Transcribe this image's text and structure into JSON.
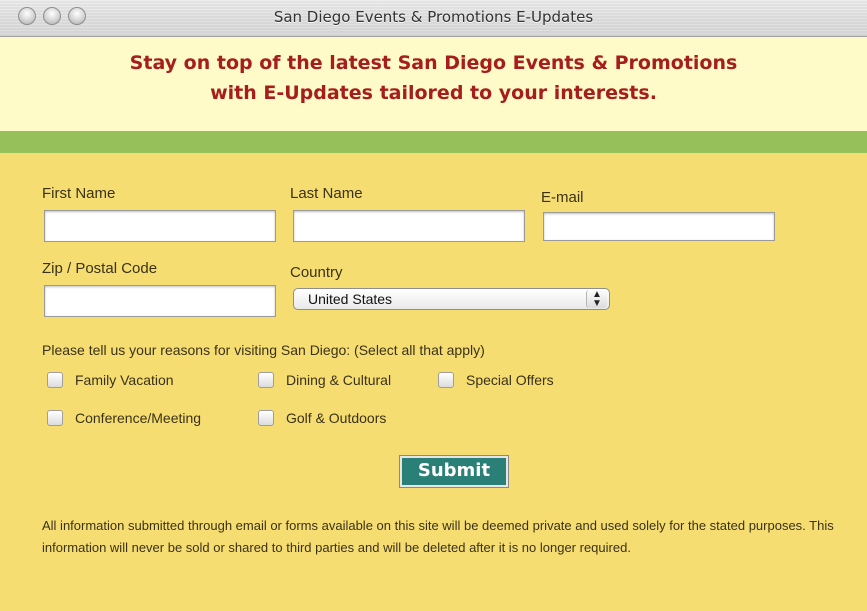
{
  "window": {
    "title": "San Diego Events & Promotions E-Updates"
  },
  "header": {
    "line1": "Stay on top of the latest San Diego Events & Promotions",
    "line2": "with E-Updates tailored to your interests."
  },
  "form": {
    "first_name": {
      "label": "First Name",
      "value": ""
    },
    "last_name": {
      "label": "Last Name",
      "value": ""
    },
    "email": {
      "label": "E-mail",
      "value": ""
    },
    "zip": {
      "label": "Zip / Postal Code",
      "value": ""
    },
    "country": {
      "label": "Country",
      "selected": "United States"
    },
    "reasons_prompt": "Please tell us your reasons for visiting San Diego: (Select all that apply)",
    "reasons": [
      {
        "label": "Family Vacation",
        "checked": false
      },
      {
        "label": "Dining & Cultural",
        "checked": false
      },
      {
        "label": "Special Offers",
        "checked": false
      },
      {
        "label": "Conference/Meeting",
        "checked": false
      },
      {
        "label": "Golf & Outdoors",
        "checked": false
      }
    ],
    "submit_label": "Submit"
  },
  "privacy": "All information submitted through email or forms available on this site will be deemed private and used solely for the stated purposes. This information will never be sold or shared to third parties and will be deleted after it is no longer required.",
  "colors": {
    "background": "#f6dd72",
    "header_bg": "#fffbc8",
    "header_text": "#a61d1d",
    "accent_bar": "#96c15a",
    "submit_bg": "#2a7f76"
  }
}
